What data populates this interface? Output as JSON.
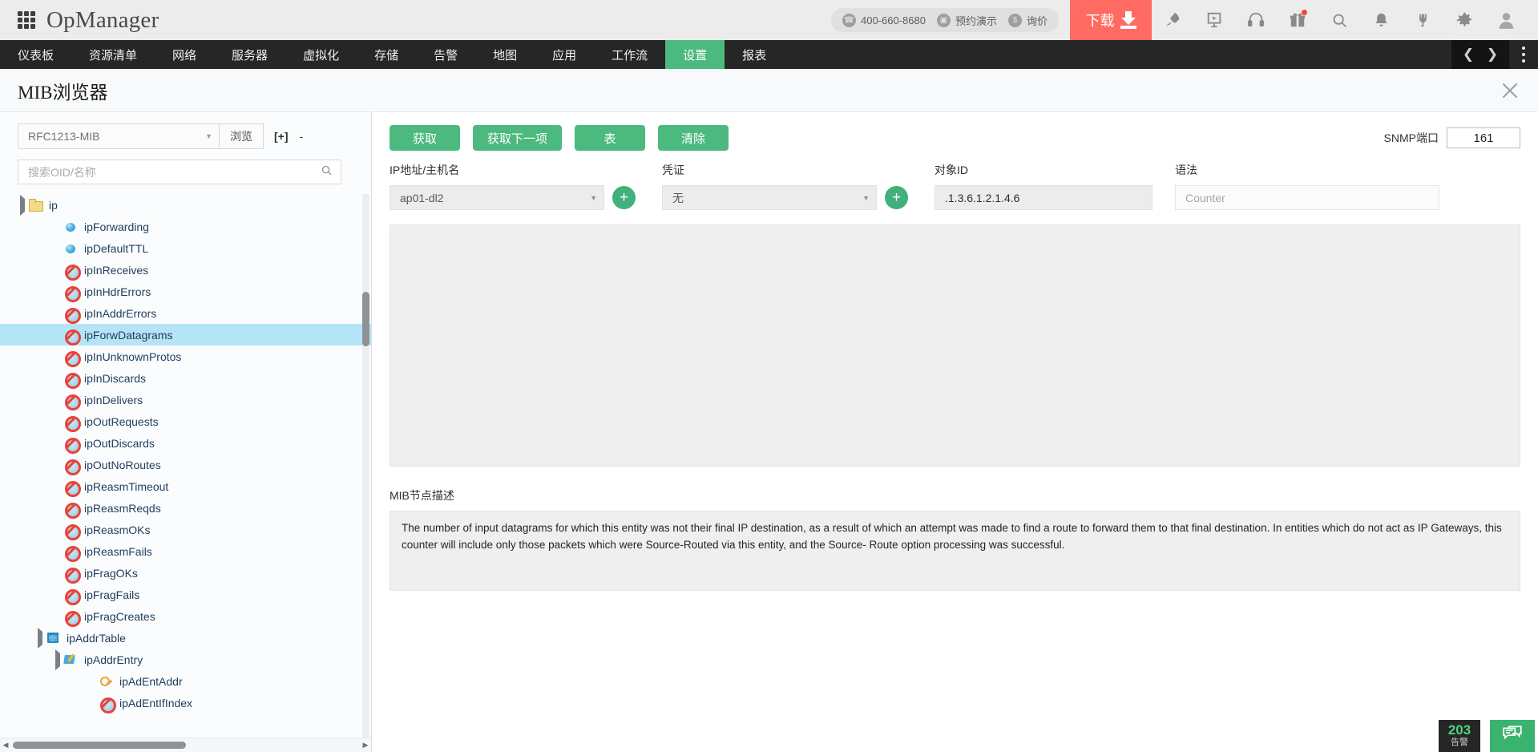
{
  "header": {
    "app_name": "OpManager",
    "grid_icon": "apps-grid-icon",
    "contact": {
      "phone_icon": "phone-icon",
      "phone": "400-660-8680",
      "demo_icon": "monitor-icon",
      "demo": "预约演示",
      "quote_icon": "dollar-icon",
      "quote": "询价"
    },
    "download_label": "下载",
    "icons": [
      {
        "name": "rocket-icon"
      },
      {
        "name": "presentation-icon"
      },
      {
        "name": "headset-icon"
      },
      {
        "name": "gift-icon"
      },
      {
        "name": "search-icon"
      },
      {
        "name": "bell-icon"
      },
      {
        "name": "plug-icon"
      },
      {
        "name": "gear-icon"
      },
      {
        "name": "avatar-icon"
      }
    ]
  },
  "nav": {
    "items": [
      {
        "label": "仪表板",
        "active": false
      },
      {
        "label": "资源清单",
        "active": false
      },
      {
        "label": "网络",
        "active": false
      },
      {
        "label": "服务器",
        "active": false
      },
      {
        "label": "虚拟化",
        "active": false
      },
      {
        "label": "存储",
        "active": false
      },
      {
        "label": "告警",
        "active": false
      },
      {
        "label": "地图",
        "active": false
      },
      {
        "label": "应用",
        "active": false
      },
      {
        "label": "工作流",
        "active": false
      },
      {
        "label": "设置",
        "active": true
      },
      {
        "label": "报表",
        "active": false
      }
    ],
    "prev_icon": "chevron-left-icon",
    "next_icon": "chevron-right-icon",
    "more_icon": "kebab-menu-icon"
  },
  "page": {
    "title": "MIB浏览器",
    "close_icon": "close-icon"
  },
  "left_panel": {
    "mib_select_value": "RFC1213-MIB",
    "browse_label": "浏览",
    "expand_all_label": "[+]",
    "collapse_all_label": "-",
    "search_placeholder": "搜索OID/名称",
    "search_value": "",
    "search_icon": "search-icon",
    "tree": [
      {
        "label": "ip",
        "icon": "folder-icon",
        "depth": 1,
        "expander": true,
        "selected": false
      },
      {
        "label": "ipForwarding",
        "icon": "sphere-icon",
        "depth": 3,
        "expander": false,
        "selected": false
      },
      {
        "label": "ipDefaultTTL",
        "icon": "sphere-icon",
        "depth": 3,
        "expander": false,
        "selected": false
      },
      {
        "label": "ipInReceives",
        "icon": "noentry-icon",
        "depth": 3,
        "expander": false,
        "selected": false
      },
      {
        "label": "ipInHdrErrors",
        "icon": "noentry-icon",
        "depth": 3,
        "expander": false,
        "selected": false
      },
      {
        "label": "ipInAddrErrors",
        "icon": "noentry-icon",
        "depth": 3,
        "expander": false,
        "selected": false
      },
      {
        "label": "ipForwDatagrams",
        "icon": "noentry-icon",
        "depth": 3,
        "expander": false,
        "selected": true
      },
      {
        "label": "ipInUnknownProtos",
        "icon": "noentry-icon",
        "depth": 3,
        "expander": false,
        "selected": false
      },
      {
        "label": "ipInDiscards",
        "icon": "noentry-icon",
        "depth": 3,
        "expander": false,
        "selected": false
      },
      {
        "label": "ipInDelivers",
        "icon": "noentry-icon",
        "depth": 3,
        "expander": false,
        "selected": false
      },
      {
        "label": "ipOutRequests",
        "icon": "noentry-icon",
        "depth": 3,
        "expander": false,
        "selected": false
      },
      {
        "label": "ipOutDiscards",
        "icon": "noentry-icon",
        "depth": 3,
        "expander": false,
        "selected": false
      },
      {
        "label": "ipOutNoRoutes",
        "icon": "noentry-icon",
        "depth": 3,
        "expander": false,
        "selected": false
      },
      {
        "label": "ipReasmTimeout",
        "icon": "noentry-icon",
        "depth": 3,
        "expander": false,
        "selected": false
      },
      {
        "label": "ipReasmReqds",
        "icon": "noentry-icon",
        "depth": 3,
        "expander": false,
        "selected": false
      },
      {
        "label": "ipReasmOKs",
        "icon": "noentry-icon",
        "depth": 3,
        "expander": false,
        "selected": false
      },
      {
        "label": "ipReasmFails",
        "icon": "noentry-icon",
        "depth": 3,
        "expander": false,
        "selected": false
      },
      {
        "label": "ipFragOKs",
        "icon": "noentry-icon",
        "depth": 3,
        "expander": false,
        "selected": false
      },
      {
        "label": "ipFragFails",
        "icon": "noentry-icon",
        "depth": 3,
        "expander": false,
        "selected": false
      },
      {
        "label": "ipFragCreates",
        "icon": "noentry-icon",
        "depth": 3,
        "expander": false,
        "selected": false
      },
      {
        "label": "ipAddrTable",
        "icon": "table-icon",
        "depth": 2,
        "expander": true,
        "selected": false
      },
      {
        "label": "ipAddrEntry",
        "icon": "entry-icon",
        "depth": 3,
        "expander": true,
        "selected": false
      },
      {
        "label": "ipAdEntAddr",
        "icon": "key-icon",
        "depth": 5,
        "expander": false,
        "selected": false
      },
      {
        "label": "ipAdEntIfIndex",
        "icon": "noentry-icon",
        "depth": 5,
        "expander": false,
        "selected": false
      }
    ]
  },
  "right_panel": {
    "buttons": [
      {
        "label": "获取",
        "name": "get-button"
      },
      {
        "label": "获取下一项",
        "name": "get-next-button"
      },
      {
        "label": "表",
        "name": "table-button"
      },
      {
        "label": "清除",
        "name": "clear-button"
      }
    ],
    "snmp_port_label": "SNMP端口",
    "snmp_port_value": "161",
    "fields": {
      "host_label": "IP地址/主机名",
      "host_value": "ap01-dl2",
      "credential_label": "凭证",
      "credential_value": "无",
      "oid_label": "对象ID",
      "oid_value": ".1.3.6.1.2.1.4.6",
      "syntax_label": "语法",
      "syntax_placeholder": "Counter"
    },
    "result_value": "",
    "desc_label": "MIB节点描述",
    "desc_text": "The number of input datagrams for which this entity was not their final IP destination, as a result of which an attempt was made to find a route to forward them to that final destination. In entities which do not act as IP Gateways, this counter will include only those packets which were Source-Routed via this entity, and the Source- Route option processing was successful."
  },
  "footer": {
    "alarm_count": "203",
    "alarm_label": "告警",
    "chat_icon": "chat-icon"
  },
  "colors": {
    "accent_green": "#4cb97e",
    "download_red": "#ff6b63",
    "nav_dark": "#262626",
    "selection_blue": "#b5e4f7"
  }
}
